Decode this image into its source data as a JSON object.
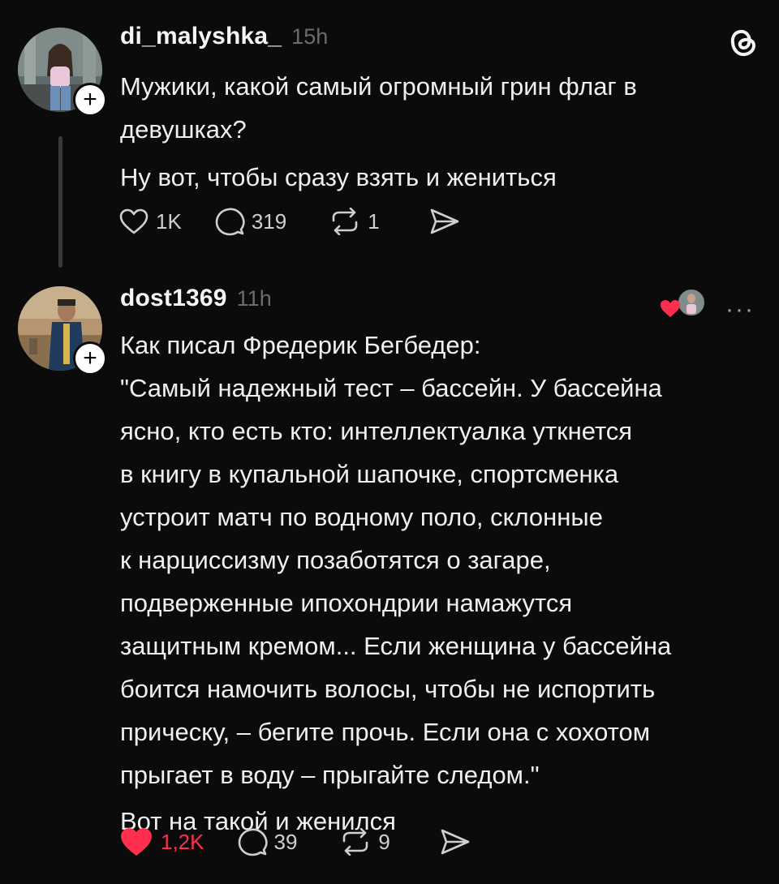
{
  "posts": [
    {
      "username": "di_malyshka_",
      "time": "15h",
      "lines": [
        "Мужики, какой самый огромный грин флаг в",
        "девушках?"
      ],
      "lines2": [
        "Ну вот, чтобы сразу взять и жениться"
      ],
      "likes": "1K",
      "comments": "319",
      "reposts": "1",
      "liked": false
    },
    {
      "username": "dost1369",
      "time": "11h",
      "lines": [
        "Как писал Фредерик Бегбедер:",
        "\"Самый надежный тест – бассейн. У бассейна",
        "ясно, кто есть кто: интеллектуалка уткнется",
        "в книгу в купальной шапочке, спортсменка",
        "устроит матч по водному поло, склонные",
        "к нарциссизму позаботятся о загаре,",
        "подверженные ипохондрии намажутся",
        "защитным кремом... Если женщина у бассейна",
        "боится намочить волосы, чтобы не испортить",
        "прическу, – бегите прочь. Если она с хохотом",
        "прыгает в воду – прыгайте следом.\"",
        "Вот на такой и женился"
      ],
      "likes": "1,2K",
      "comments": "39",
      "reposts": "9",
      "liked": true
    }
  ],
  "icons": {
    "like": "heart-icon",
    "comment": "comment-bubble-icon",
    "repost": "repost-icon",
    "share": "send-icon",
    "app": "threads-logo-icon",
    "follow": "plus-icon",
    "more": "more-dots-icon"
  },
  "colors": {
    "background": "#0b0b0c",
    "text": "#efefef",
    "muted": "#6c6c70",
    "like_active": "#ff2e4c"
  },
  "more_label": "···",
  "plus_label": "+"
}
